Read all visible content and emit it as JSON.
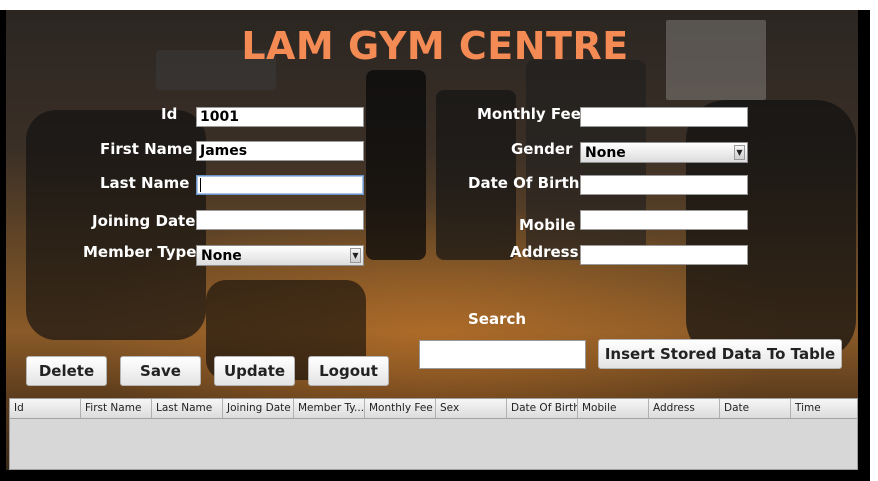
{
  "app": {
    "title": "LAM GYM CENTRE"
  },
  "form": {
    "id": {
      "label": "Id",
      "value": "1001"
    },
    "first_name": {
      "label": "First Name",
      "value": "James"
    },
    "last_name": {
      "label": "Last Name",
      "value": ""
    },
    "joining_date": {
      "label": "Joining Date",
      "value": ""
    },
    "member_type": {
      "label": "Member Type",
      "value": "None"
    },
    "monthly_fee": {
      "label": "Monthly Fee",
      "value": ""
    },
    "gender": {
      "label": "Gender",
      "value": "None"
    },
    "date_of_birth": {
      "label": "Date Of Birth",
      "value": ""
    },
    "mobile": {
      "label": "Mobile",
      "value": ""
    },
    "address": {
      "label": "Address",
      "value": ""
    }
  },
  "search": {
    "label": "Search",
    "value": ""
  },
  "buttons": {
    "delete": "Delete",
    "save": "Save",
    "update": "Update",
    "logout": "Logout",
    "insert": "Insert Stored Data To Table"
  },
  "table": {
    "columns": [
      "Id",
      "First Name",
      "Last Name",
      "Joining Date",
      "Member Ty...",
      "Monthly Fee",
      "Sex",
      "Date Of Birth",
      "Mobile",
      "Address",
      "Date",
      "Time"
    ]
  }
}
